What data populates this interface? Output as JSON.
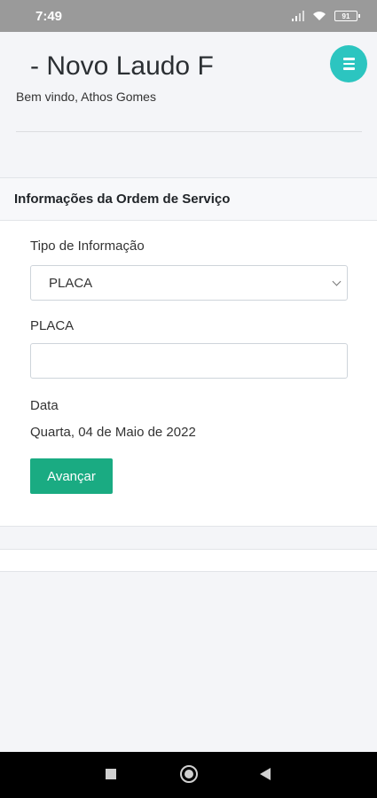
{
  "status_bar": {
    "time": "7:49",
    "battery": "91"
  },
  "header": {
    "title": "- Novo Laudo F",
    "welcome": "Bem vindo, Athos Gomes"
  },
  "card": {
    "title": "Informações da Ordem de Serviço",
    "info_type_label": "Tipo de Informação",
    "info_type_value": "PLACA",
    "plate_label": "PLACA",
    "plate_value": "",
    "date_label": "Data",
    "date_value": "Quarta, 04 de Maio de 2022",
    "advance_label": "Avançar"
  },
  "colors": {
    "accent_teal": "#2cc5c0",
    "button_green": "#1aab82"
  },
  "icons": {
    "menu": "hamburger-icon",
    "signal": "signal-icon",
    "wifi": "wifi-icon",
    "battery": "battery-icon"
  }
}
